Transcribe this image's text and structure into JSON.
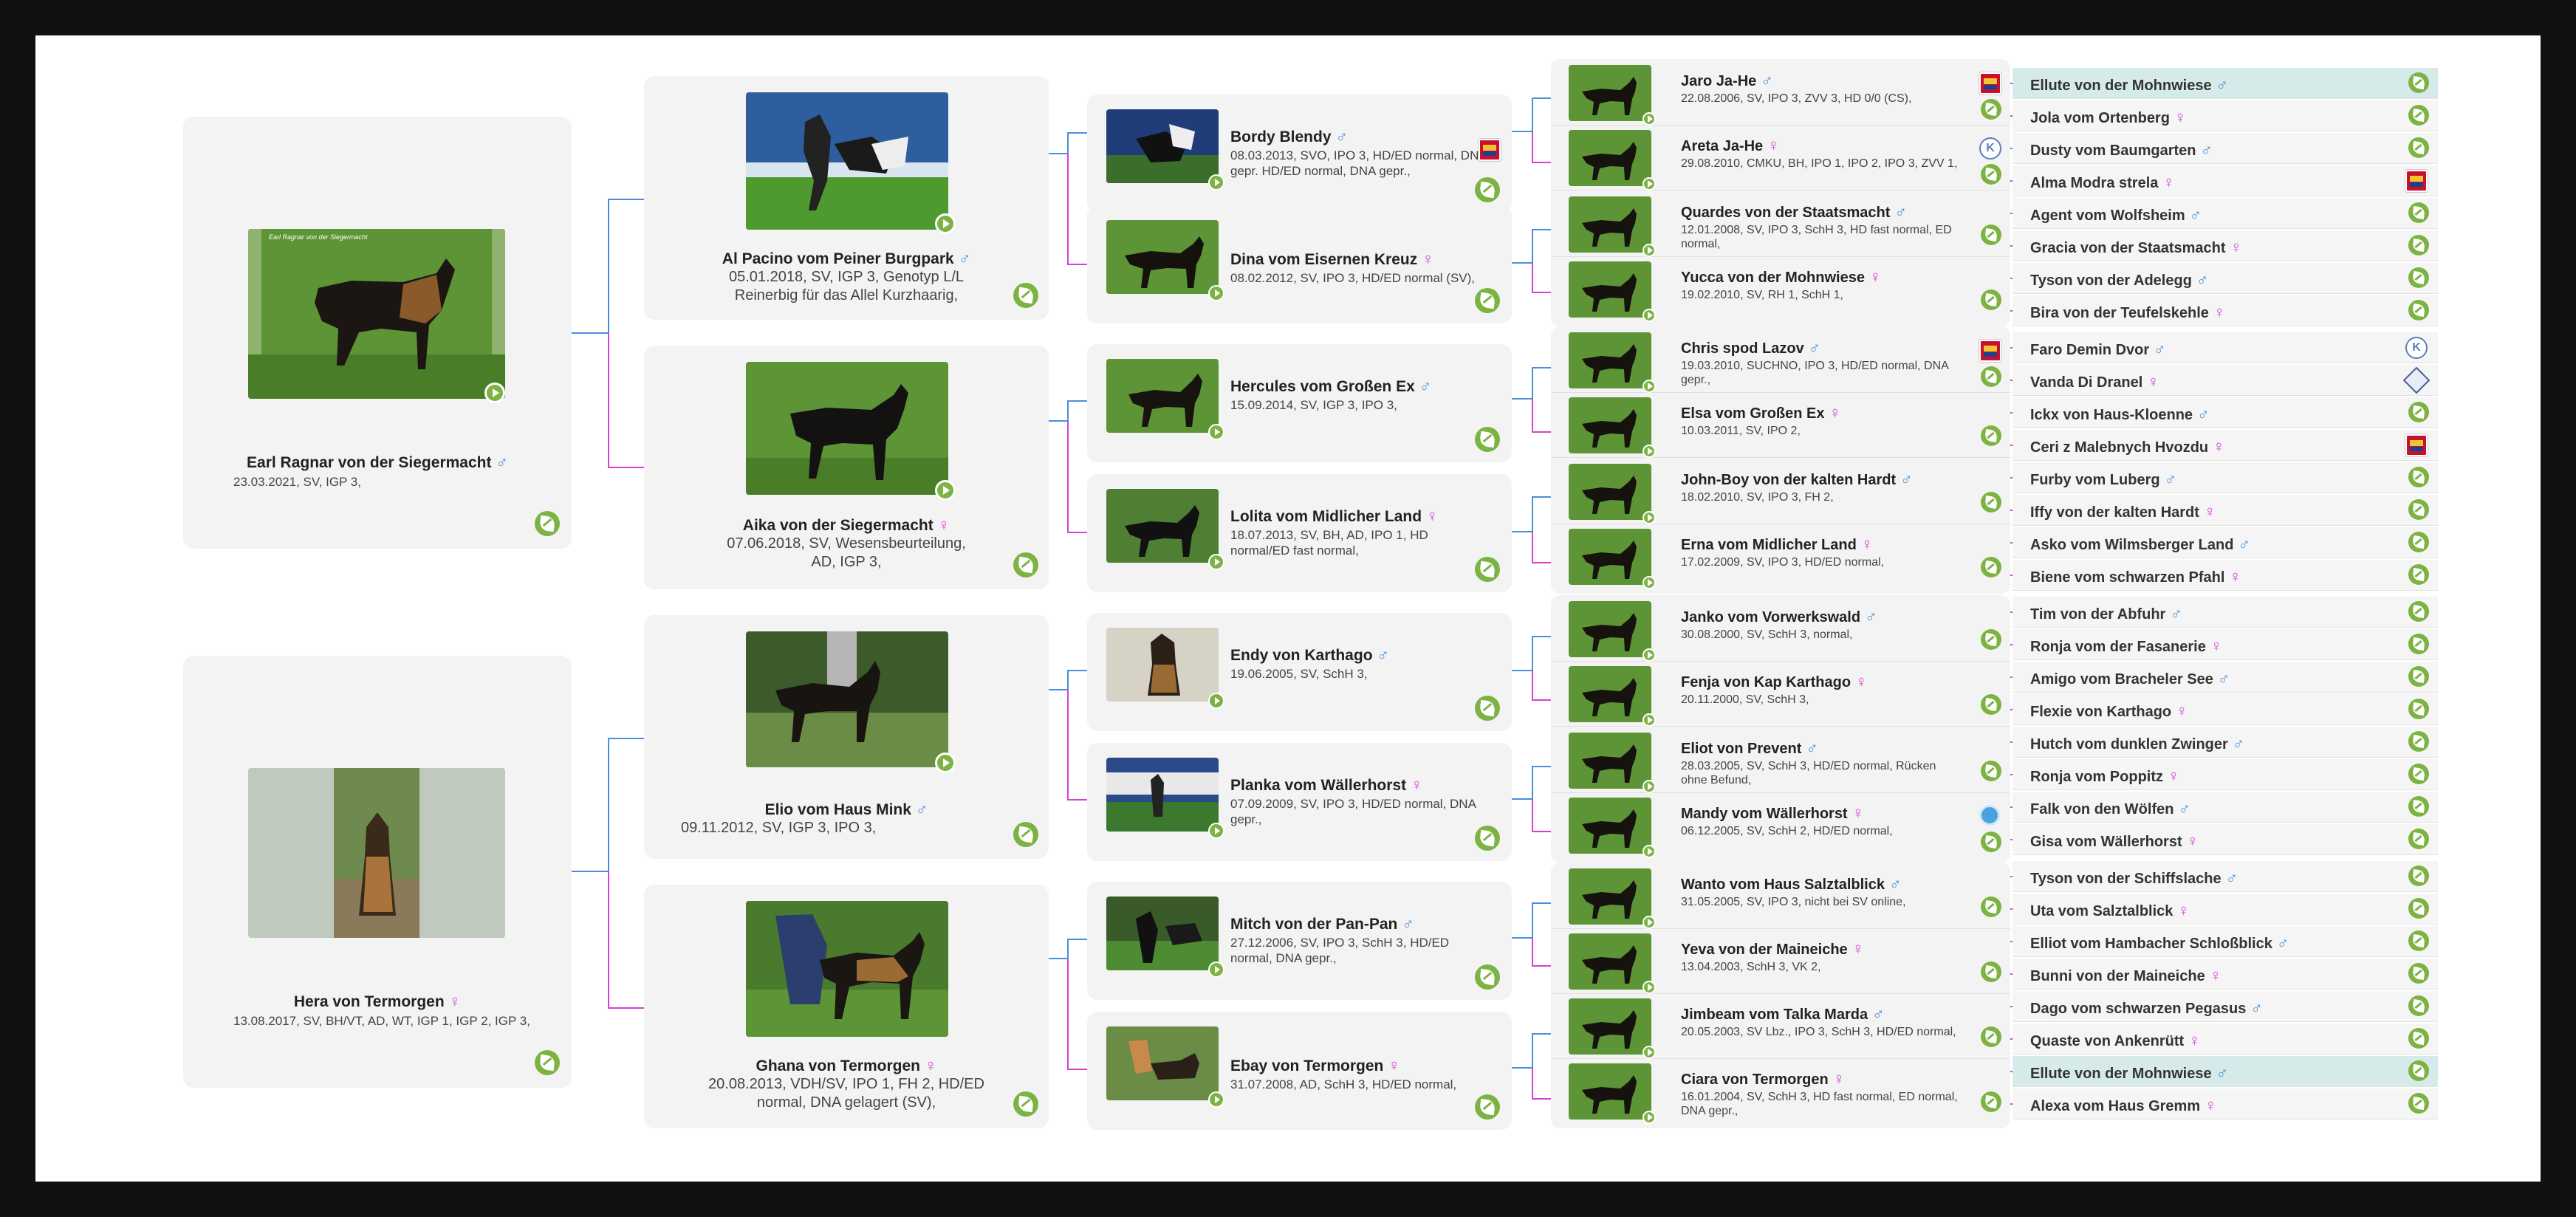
{
  "pedigree": {
    "gen1": [
      {
        "name": "Earl Ragnar von der Siegermacht",
        "sex": "♂",
        "info": "23.03.2021, SV, IGP 3,",
        "photo_text": "Earl Ragnar von der Siegermacht"
      },
      {
        "name": "Hera von Termorgen",
        "sex": "♀",
        "info": "13.08.2017, SV, BH/VT, AD, WT, IGP 1, IGP 2, IGP 3,"
      }
    ],
    "gen2": [
      {
        "name": "Al Pacino vom Peiner Burgpark",
        "sex": "♂",
        "info": "05.01.2018, SV, IGP 3, Genotyp L/L Reinerbig für das Allel Kurzhaarig,"
      },
      {
        "name": "Aika von der Siegermacht",
        "sex": "♀",
        "info": "07.06.2018, SV, Wesensbeurteilung, AD, IGP 3,"
      },
      {
        "name": "Elio vom Haus Mink",
        "sex": "♂",
        "info": "09.11.2012, SV, IGP 3, IPO 3,"
      },
      {
        "name": "Ghana von Termorgen",
        "sex": "♀",
        "info": "20.08.2013, VDH/SV, IPO 1, FH 2, HD/ED normal, DNA gelagert (SV),"
      }
    ],
    "gen3": [
      {
        "name": "Bordy Blendy",
        "sex": "♂",
        "info": "08.03.2013, SVO, IPO 3, HD/ED normal, DNA gepr. HD/ED normal, DNA gepr.,"
      },
      {
        "name": "Dina vom Eisernen Kreuz",
        "sex": "♀",
        "info": "08.02.2012, SV, IPO 3, HD/ED normal (SV),"
      },
      {
        "name": "Hercules vom Großen Ex",
        "sex": "♂",
        "info": "15.09.2014, SV, IGP 3, IPO 3,"
      },
      {
        "name": "Lolita vom Midlicher Land",
        "sex": "♀",
        "info": "18.07.2013, SV, BH, AD, IPO 1, HD normal/ED fast normal,"
      },
      {
        "name": "Endy von Karthago",
        "sex": "♂",
        "info": "19.06.2005, SV, SchH 3,"
      },
      {
        "name": "Planka vom Wällerhorst",
        "sex": "♀",
        "info": "07.09.2009, SV, IPO 3, HD/ED normal, DNA gepr.,"
      },
      {
        "name": "Mitch von der Pan-Pan",
        "sex": "♂",
        "info": "27.12.2006, SV, IPO 3, SchH 3, HD/ED normal, DNA gepr.,"
      },
      {
        "name": "Ebay von Termorgen",
        "sex": "♀",
        "info": "31.07.2008, AD, SchH 3, HD/ED normal,"
      }
    ],
    "gen4": [
      {
        "name": "Jaro Ja-He",
        "sex": "♂",
        "info": "22.08.2006, SV, IPO 3, ZVV 3, HD 0/0 (CS),"
      },
      {
        "name": "Areta Ja-He",
        "sex": "♀",
        "info": "29.08.2010, CMKU, BH, IPO 1, IPO 2, IPO 3, ZVV 1,"
      },
      {
        "name": "Quardes von der Staatsmacht",
        "sex": "♂",
        "info": "12.01.2008, SV, IPO 3, SchH 3, HD fast normal, ED normal,"
      },
      {
        "name": "Yucca von der Mohnwiese",
        "sex": "♀",
        "info": "19.02.2010, SV, RH 1, SchH 1,"
      },
      {
        "name": "Chris spod Lazov",
        "sex": "♂",
        "info": "19.03.2010, SUCHNO, IPO 3, HD/ED normal, DNA gepr.,"
      },
      {
        "name": "Elsa vom Großen Ex",
        "sex": "♀",
        "info": "10.03.2011, SV, IPO 2,"
      },
      {
        "name": "John-Boy von der kalten Hardt",
        "sex": "♂",
        "info": "18.02.2010, SV, IPO 3, FH 2,"
      },
      {
        "name": "Erna vom Midlicher Land",
        "sex": "♀",
        "info": "17.02.2009, SV, IPO 3, HD/ED normal,"
      },
      {
        "name": "Janko vom Vorwerkswald",
        "sex": "♂",
        "info": "30.08.2000, SV, SchH 3, normal,"
      },
      {
        "name": "Fenja von Kap Karthago",
        "sex": "♀",
        "info": "20.11.2000, SV, SchH 3,"
      },
      {
        "name": "Eliot von Prevent",
        "sex": "♂",
        "info": "28.03.2005, SV, SchH 3, HD/ED normal, Rücken ohne Befund,"
      },
      {
        "name": "Mandy vom Wällerhorst",
        "sex": "♀",
        "info": "06.12.2005, SV, SchH 2, HD/ED normal,"
      },
      {
        "name": "Wanto vom Haus Salztalblick",
        "sex": "♂",
        "info": "31.05.2005, SV, IPO 3, nicht bei SV online,"
      },
      {
        "name": "Yeva von der Maineiche",
        "sex": "♀",
        "info": "13.04.2003, SchH 3, VK 2,"
      },
      {
        "name": "Jimbeam vom Talka Marda",
        "sex": "♂",
        "info": "20.05.2003, SV Lbz., IPO 3, SchH 3, HD/ED normal,"
      },
      {
        "name": "Ciara von Termorgen",
        "sex": "♀",
        "info": "16.01.2004, SV, SchH 3, HD fast normal, ED normal, DNA gepr.,"
      }
    ],
    "gen5": [
      {
        "name": "Ellute von der Mohnwiese",
        "sex": "♂"
      },
      {
        "name": "Jola vom Ortenberg",
        "sex": "♀"
      },
      {
        "name": "Dusty vom Baumgarten",
        "sex": "♂"
      },
      {
        "name": "Alma Modra strela",
        "sex": "♀"
      },
      {
        "name": "Agent vom Wolfsheim",
        "sex": "♂"
      },
      {
        "name": "Gracia von der Staatsmacht",
        "sex": "♀"
      },
      {
        "name": "Tyson von der Adelegg",
        "sex": "♂"
      },
      {
        "name": "Bira von der Teufelskehle",
        "sex": "♀"
      },
      {
        "name": "Faro Demin Dvor",
        "sex": "♂"
      },
      {
        "name": "Vanda Di Dranel",
        "sex": "♀"
      },
      {
        "name": "Ickx von Haus-Kloenne",
        "sex": "♂"
      },
      {
        "name": "Ceri z Malebnych Hvozdu",
        "sex": "♀"
      },
      {
        "name": "Furby vom Luberg",
        "sex": "♂"
      },
      {
        "name": "Iffy von der kalten Hardt",
        "sex": "♀"
      },
      {
        "name": "Asko vom Wilmsberger Land",
        "sex": "♂"
      },
      {
        "name": "Biene vom schwarzen Pfahl",
        "sex": "♀"
      },
      {
        "name": "Tim von der Abfuhr",
        "sex": "♂"
      },
      {
        "name": "Ronja vom der Fasanerie",
        "sex": "♀"
      },
      {
        "name": "Amigo vom Bracheler See",
        "sex": "♂"
      },
      {
        "name": "Flexie von Karthago",
        "sex": "♀"
      },
      {
        "name": "Hutch vom dunklen Zwinger",
        "sex": "♂"
      },
      {
        "name": "Ronja vom Poppitz",
        "sex": "♀"
      },
      {
        "name": "Falk von den Wölfen",
        "sex": "♂"
      },
      {
        "name": "Gisa vom Wällerhorst",
        "sex": "♀"
      },
      {
        "name": "Tyson von der Schiffslache",
        "sex": "♂"
      },
      {
        "name": "Uta vom Salztalblick",
        "sex": "♀"
      },
      {
        "name": "Elliot vom Hambacher Schloßblick",
        "sex": "♂"
      },
      {
        "name": "Bunni von der Maineiche",
        "sex": "♀"
      },
      {
        "name": "Dago vom schwarzen Pegasus",
        "sex": "♂"
      },
      {
        "name": "Quaste von Ankenrütt",
        "sex": "♀"
      },
      {
        "name": "Ellute von der Mohnwiese",
        "sex": "♂"
      },
      {
        "name": "Alexa vom Haus Gremm",
        "sex": "♀"
      }
    ]
  },
  "colors": {
    "male": "#4a90d9",
    "female": "#d63fd6",
    "accent_green": "#7cb342",
    "highlight_row": "#d6eaea"
  },
  "icons": {
    "play": "play-button-icon",
    "leaf": "green-leaf-icon",
    "flag": "breed-club-flag-icon",
    "club": "club-logo-icon"
  }
}
